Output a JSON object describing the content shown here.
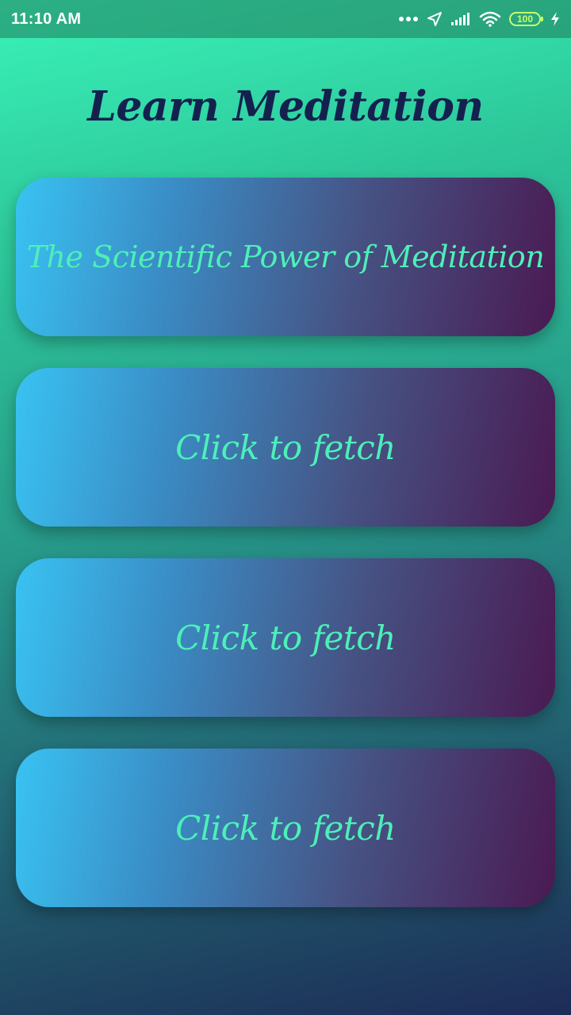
{
  "status_bar": {
    "time": "11:10 AM",
    "battery": "100",
    "icons": [
      "more-dots-icon",
      "location-arrow-icon",
      "signal-icon",
      "wifi-icon",
      "battery-icon",
      "charging-bolt-icon"
    ]
  },
  "app": {
    "title": "Learn Meditation"
  },
  "cards": [
    {
      "label": "The Scientific Power of Meditation"
    },
    {
      "label": "Click to fetch"
    },
    {
      "label": "Click to fetch"
    },
    {
      "label": "Click to fetch"
    }
  ],
  "colors": {
    "title": "#14214f",
    "card_text": "#4df0b8",
    "card_gradient_start": "#39c3f2",
    "card_gradient_end": "#4a1a52",
    "background_top": "#3af3b8",
    "background_bottom": "#1d2b58",
    "battery": "#c6ff6a"
  }
}
